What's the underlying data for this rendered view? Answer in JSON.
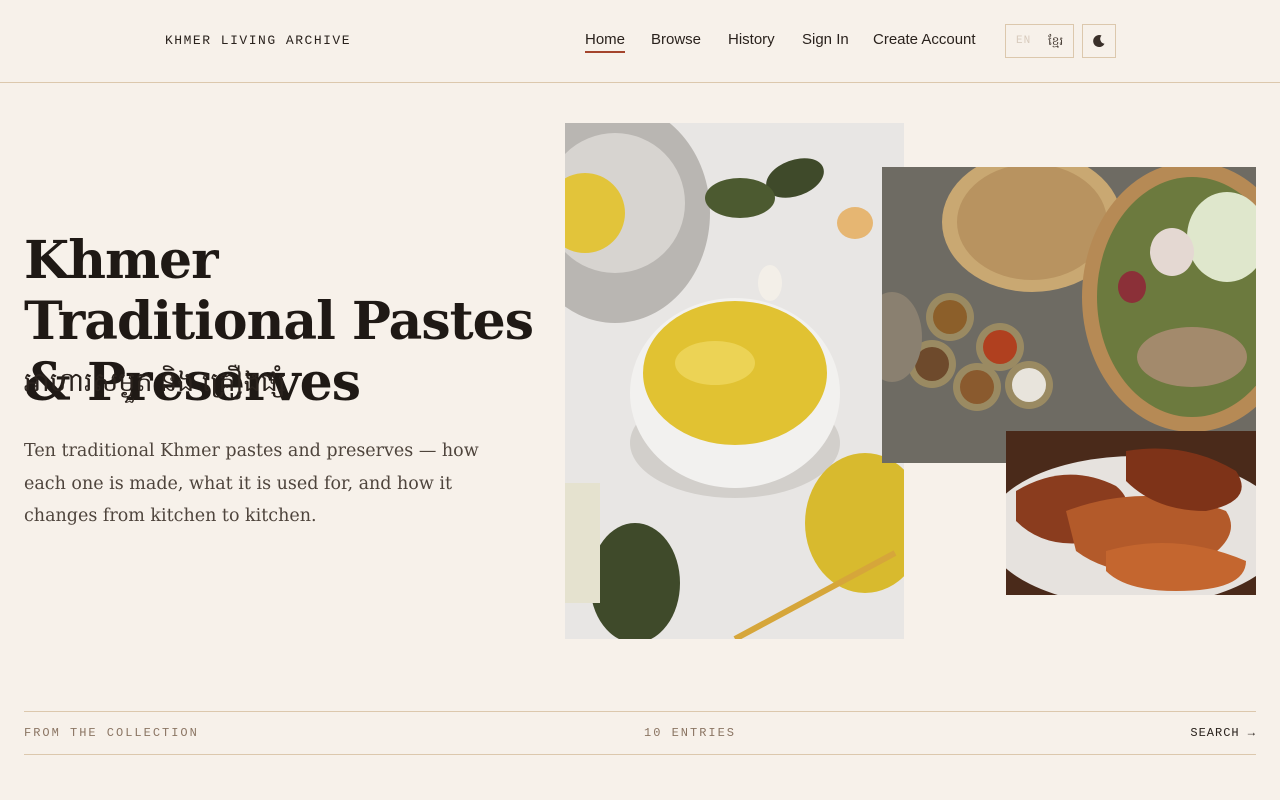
{
  "header": {
    "brand": "KHMER LIVING ARCHIVE",
    "nav": [
      {
        "label": "Home",
        "active": true
      },
      {
        "label": "Browse",
        "active": false
      },
      {
        "label": "History",
        "active": false
      },
      {
        "label": "Sign In",
        "active": false
      },
      {
        "label": "Create Account",
        "active": false
      }
    ],
    "lang_en": "EN",
    "lang_km": "ខ្មែរ",
    "theme_icon": "moon-icon"
  },
  "hero": {
    "title": "Khmer Traditional Pastes & Preserves",
    "title_khmer": "អាហារសម្ងួត និង គ្រឿងផ្សំ",
    "description": "Ten traditional Khmer pastes and preserves — how each one is made, what it is used for, and how it changes from kitchen to kitchen."
  },
  "photos": [
    {
      "name": "kroeung-paste-bowl-photo"
    },
    {
      "name": "spices-and-baskets-photo"
    },
    {
      "name": "dried-fish-plate-photo"
    }
  ],
  "footer": {
    "from_label": "FROM THE COLLECTION",
    "count_label": "10 ENTRIES",
    "search_label": "SEARCH →"
  },
  "colors": {
    "background": "#f7f1ea",
    "accent": "#a4442c",
    "border": "#dcc8ad"
  }
}
